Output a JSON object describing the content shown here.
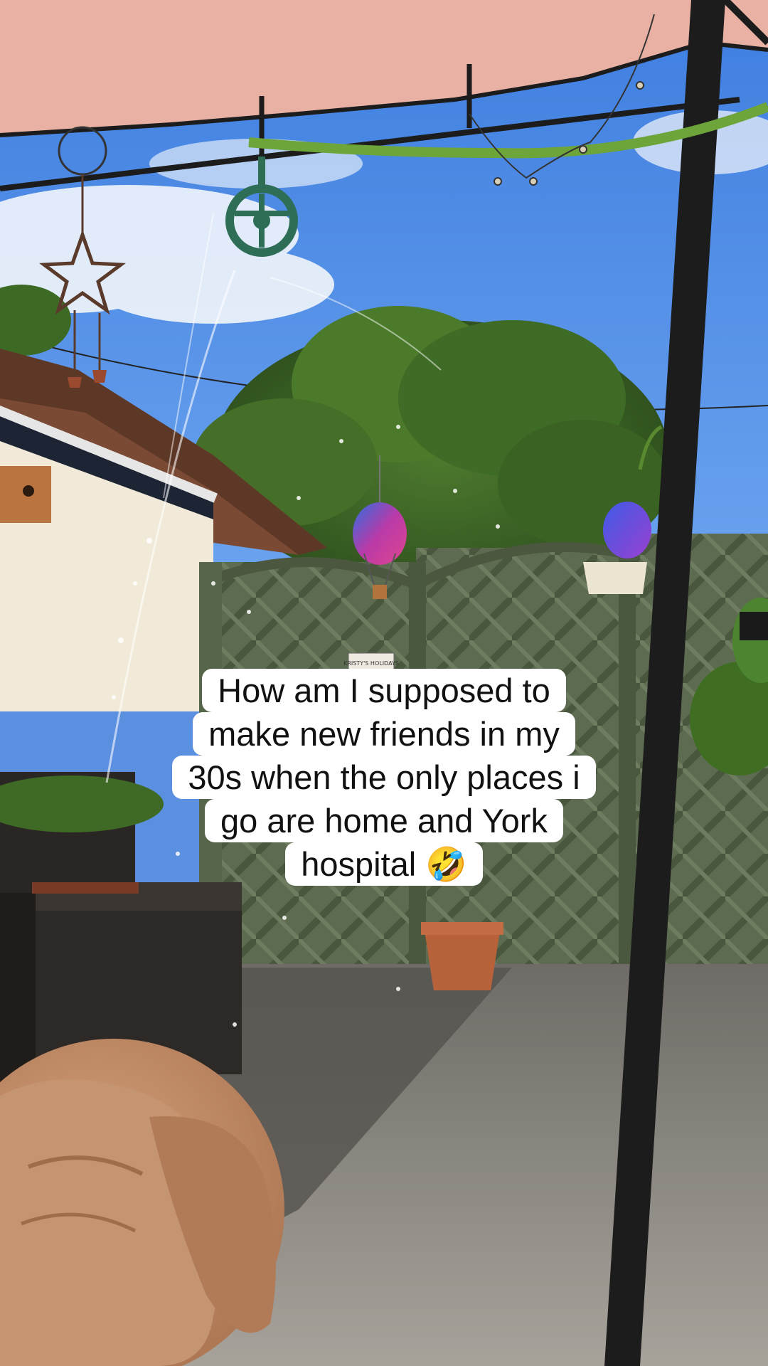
{
  "caption": {
    "lines": [
      "How am I supposed to",
      "make new friends in my",
      "30s when the only places i",
      "go are home and York",
      "hospital 🤣"
    ]
  },
  "sign_text": "KRISTY'S HOLIDAYS",
  "colors": {
    "sky": "#4f88e4",
    "canopy": "#e8b1a3",
    "frame": "#1c1c1c",
    "fence": "#5b6b4e",
    "tree": "#3f6a28",
    "wall": "#f1ead8",
    "roof": "#7a4a34",
    "ground": "#8d8a84",
    "dog": "#c49068",
    "caption_bg": "#ffffff",
    "caption_text": "#111111"
  }
}
